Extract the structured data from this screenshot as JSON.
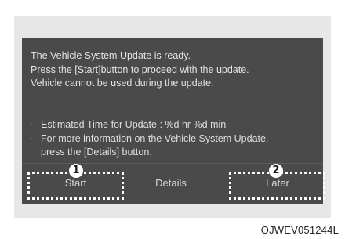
{
  "message": {
    "lines": [
      "The Vehicle System Update is ready.",
      "Press the [Start]button to proceed with the update.",
      "Vehicle cannot be used during the update."
    ]
  },
  "info": {
    "bullet": "·",
    "lines": [
      "Estimated Time for Update : %d hr %d min",
      "For more information on the Vehicle System Update.",
      "press the [Details] button."
    ]
  },
  "buttons": {
    "start_label": "Start",
    "details_label": "Details",
    "later_label": "Later"
  },
  "callouts": {
    "first": "1",
    "second": "2"
  },
  "figure_code": "OJWEV051244L"
}
